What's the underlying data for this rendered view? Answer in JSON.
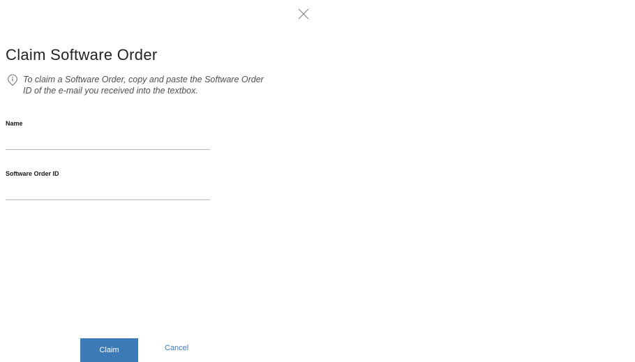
{
  "dialog": {
    "title": "Claim Software Order",
    "info": "To claim a Software Order, copy and paste the Software Order ID of the e-mail you received into the textbox.",
    "close_icon": "close-icon",
    "info_icon": "info-icon"
  },
  "fields": {
    "name": {
      "label": "Name",
      "value": "",
      "placeholder": ""
    },
    "order_id": {
      "label": "Software Order ID",
      "value": "",
      "placeholder": ""
    }
  },
  "actions": {
    "claim_label": "Claim",
    "cancel_label": "Cancel"
  },
  "colors": {
    "primary": "#3d7ab8",
    "text": "#222222",
    "muted": "#4f4f4f",
    "field_border": "#b9b9b9"
  }
}
